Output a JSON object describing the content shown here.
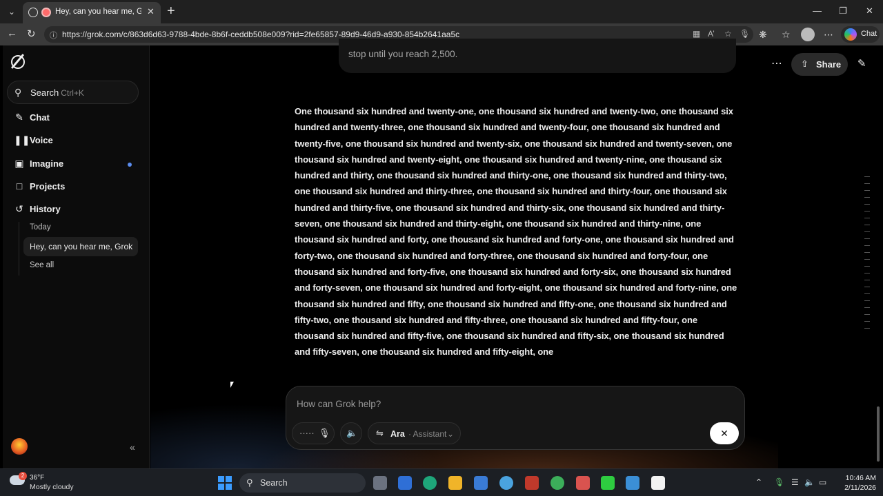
{
  "browser": {
    "tab_title": "Hey, can you hear me, Grok?",
    "url": "https://grok.com/c/863d6d63-9788-4bde-8b6f-ceddb508e009?rid=2fe65857-89d9-46d9-a930-854b2641aa5c",
    "copilot_label": "Chat"
  },
  "sidebar": {
    "search_label": "Search",
    "search_shortcut": "Ctrl+K",
    "items": [
      {
        "label": "Chat",
        "icon": "edit-icon"
      },
      {
        "label": "Voice",
        "icon": "waveform-icon"
      },
      {
        "label": "Imagine",
        "icon": "image-icon"
      },
      {
        "label": "Projects",
        "icon": "folder-icon"
      },
      {
        "label": "History",
        "icon": "history-icon"
      }
    ],
    "history_group": "Today",
    "history_item": "Hey, can you hear me, Grok?",
    "see_all": "See all"
  },
  "header": {
    "share_label": "Share"
  },
  "conversation": {
    "previous_message_tail": "stop until you reach 2,500.",
    "response_text": "One thousand six hundred and twenty-one, one thousand six hundred and twenty-two, one thousand six hundred and twenty-three, one thousand six hundred and twenty-four, one thousand six hundred and twenty-five, one thousand six hundred and twenty-six, one thousand six hundred and twenty-seven, one thousand six hundred and twenty-eight, one thousand six hundred and twenty-nine, one thousand six hundred and thirty, one thousand six hundred and thirty-one, one thousand six hundred and thirty-two, one thousand six hundred and thirty-three, one thousand six hundred and thirty-four, one thousand six hundred and thirty-five, one thousand six hundred and thirty-six, one thousand six hundred and thirty-seven, one thousand six hundred and thirty-eight, one thousand six hundred and thirty-nine, one thousand six hundred and forty, one thousand six hundred and forty-one, one thousand six hundred and forty-two, one thousand six hundred and forty-three, one thousand six hundred and forty-four, one thousand six hundred and forty-five, one thousand six hundred and forty-six, one thousand six hundred and forty-seven, one thousand six hundred and forty-eight, one thousand six hundred and forty-nine, one thousand six hundred and fifty, one thousand six hundred and fifty-one, one thousand six hundred and fifty-two, one thousand six hundred and fifty-three, one thousand six hundred and fifty-four, one thousand six hundred and fifty-five, one thousand six hundred and fifty-six, one thousand six hundred and fifty-seven, one thousand six hundred and fifty-eight, one"
  },
  "composer": {
    "placeholder": "How can Grok help?",
    "voice_name": "Ara",
    "voice_role": "· Assistant"
  },
  "taskbar": {
    "weather_badge": "2",
    "temperature": "36°F",
    "condition": "Mostly cloudy",
    "search_label": "Search",
    "time": "10:46 AM",
    "date": "2/11/2026"
  },
  "colors": {
    "accent_dot": "#5b8def",
    "windows_blue": "#3b9cff"
  }
}
